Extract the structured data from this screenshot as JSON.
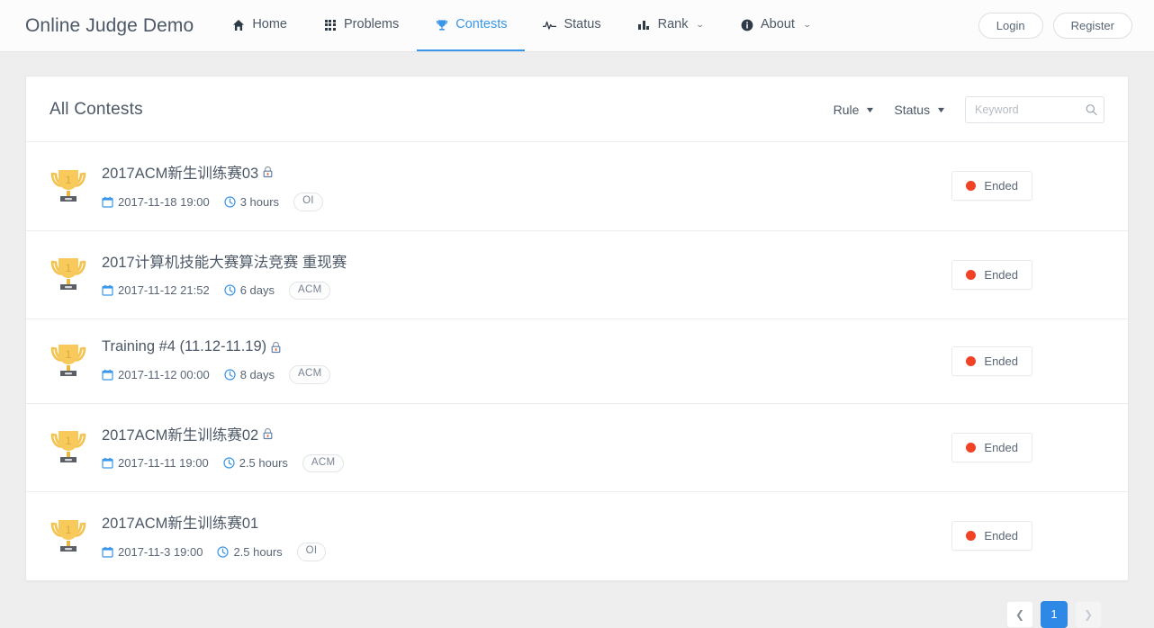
{
  "theme": {
    "accent": "#2e88e5",
    "nav_active": "#3a96e8",
    "page_bg": "#eeeeee",
    "card_bg": "#ffffff",
    "text": "#4d5867",
    "muted": "#7a8494",
    "ended_dot": "#f04224",
    "trophy_gold": "#f7c559",
    "trophy_base": "#5b6068"
  },
  "navbar": {
    "brand": "Online Judge Demo",
    "items": [
      {
        "label": "Home",
        "icon": "home-icon",
        "active": false,
        "caret": false
      },
      {
        "label": "Problems",
        "icon": "grid-icon",
        "active": false,
        "caret": false
      },
      {
        "label": "Contests",
        "icon": "trophy-icon",
        "active": true,
        "caret": false
      },
      {
        "label": "Status",
        "icon": "pulse-icon",
        "active": false,
        "caret": false
      },
      {
        "label": "Rank",
        "icon": "bar-chart-icon",
        "active": false,
        "caret": true
      },
      {
        "label": "About",
        "icon": "info-icon",
        "active": false,
        "caret": true
      }
    ],
    "login_label": "Login",
    "register_label": "Register"
  },
  "main": {
    "title": "All Contests",
    "filters": {
      "rule_label": "Rule",
      "status_label": "Status",
      "search_placeholder": "Keyword",
      "search_value": "",
      "search_icon": "search-icon"
    },
    "contests": [
      {
        "title": "2017ACM新生训练赛03",
        "locked": true,
        "start_time": "2017-11-18 19:00",
        "duration": "3 hours",
        "rule": "OI",
        "status": "Ended",
        "status_color": "#f04224",
        "trophy_icon": "trophy-icon",
        "calendar_icon": "calendar-icon",
        "clock_icon": "clock-icon",
        "lock_icon": "lock-icon"
      },
      {
        "title": "2017计算机技能大赛算法竞赛 重现赛",
        "locked": false,
        "start_time": "2017-11-12 21:52",
        "duration": "6 days",
        "rule": "ACM",
        "status": "Ended",
        "status_color": "#f04224",
        "trophy_icon": "trophy-icon",
        "calendar_icon": "calendar-icon",
        "clock_icon": "clock-icon",
        "lock_icon": ""
      },
      {
        "title": "Training #4 (11.12-11.19)",
        "locked": true,
        "start_time": "2017-11-12 00:00",
        "duration": "8 days",
        "rule": "ACM",
        "status": "Ended",
        "status_color": "#f04224",
        "trophy_icon": "trophy-icon",
        "calendar_icon": "calendar-icon",
        "clock_icon": "clock-icon",
        "lock_icon": "lock-icon"
      },
      {
        "title": "2017ACM新生训练赛02",
        "locked": true,
        "start_time": "2017-11-11 19:00",
        "duration": "2.5 hours",
        "rule": "ACM",
        "status": "Ended",
        "status_color": "#f04224",
        "trophy_icon": "trophy-icon",
        "calendar_icon": "calendar-icon",
        "clock_icon": "clock-icon",
        "lock_icon": "lock-icon"
      },
      {
        "title": "2017ACM新生训练赛01",
        "locked": false,
        "start_time": "2017-11-3 19:00",
        "duration": "2.5 hours",
        "rule": "OI",
        "status": "Ended",
        "status_color": "#f04224",
        "trophy_icon": "trophy-icon",
        "calendar_icon": "calendar-icon",
        "clock_icon": "clock-icon",
        "lock_icon": ""
      }
    ]
  },
  "pagination": {
    "prev_icon": "chevron-left-icon",
    "next_icon": "chevron-right-icon",
    "pages": [
      "1"
    ],
    "current": "1"
  }
}
